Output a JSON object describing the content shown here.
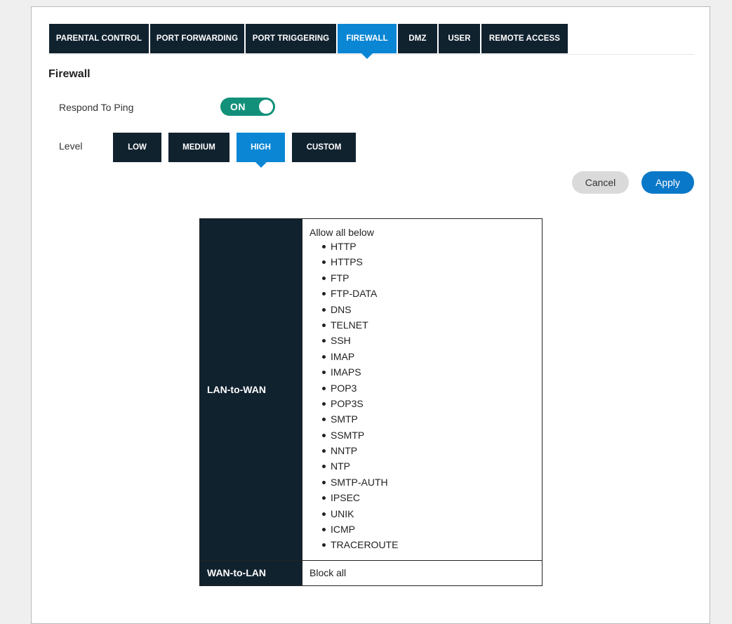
{
  "tabs": [
    "PARENTAL CONTROL",
    "PORT FORWARDING",
    "PORT TRIGGERING",
    "FIREWALL",
    "DMZ",
    "USER",
    "REMOTE ACCESS"
  ],
  "active_tab": "FIREWALL",
  "page_title": "Firewall",
  "respond_to_ping": {
    "label": "Respond To Ping",
    "toggle_text": "ON",
    "state": "on"
  },
  "level": {
    "label": "Level",
    "options": [
      "LOW",
      "MEDIUM",
      "HIGH",
      "CUSTOM"
    ],
    "selected": "HIGH"
  },
  "buttons": {
    "cancel": "Cancel",
    "apply": "Apply"
  },
  "rules": {
    "lan_to_wan": {
      "label": "LAN-to-WAN",
      "intro": "Allow all below",
      "protocols": [
        "HTTP",
        "HTTPS",
        "FTP",
        "FTP-DATA",
        "DNS",
        "TELNET",
        "SSH",
        "IMAP",
        "IMAPS",
        "POP3",
        "POP3S",
        "SMTP",
        "SSMTP",
        "NNTP",
        "NTP",
        "SMTP-AUTH",
        "IPSEC",
        "UNIK",
        "ICMP",
        "TRACEROUTE"
      ]
    },
    "wan_to_lan": {
      "label": "WAN-to-LAN",
      "value": "Block all"
    }
  },
  "colors": {
    "nav_dark": "#11222f",
    "accent_blue": "#0a86d4",
    "toggle_green": "#12907a"
  }
}
